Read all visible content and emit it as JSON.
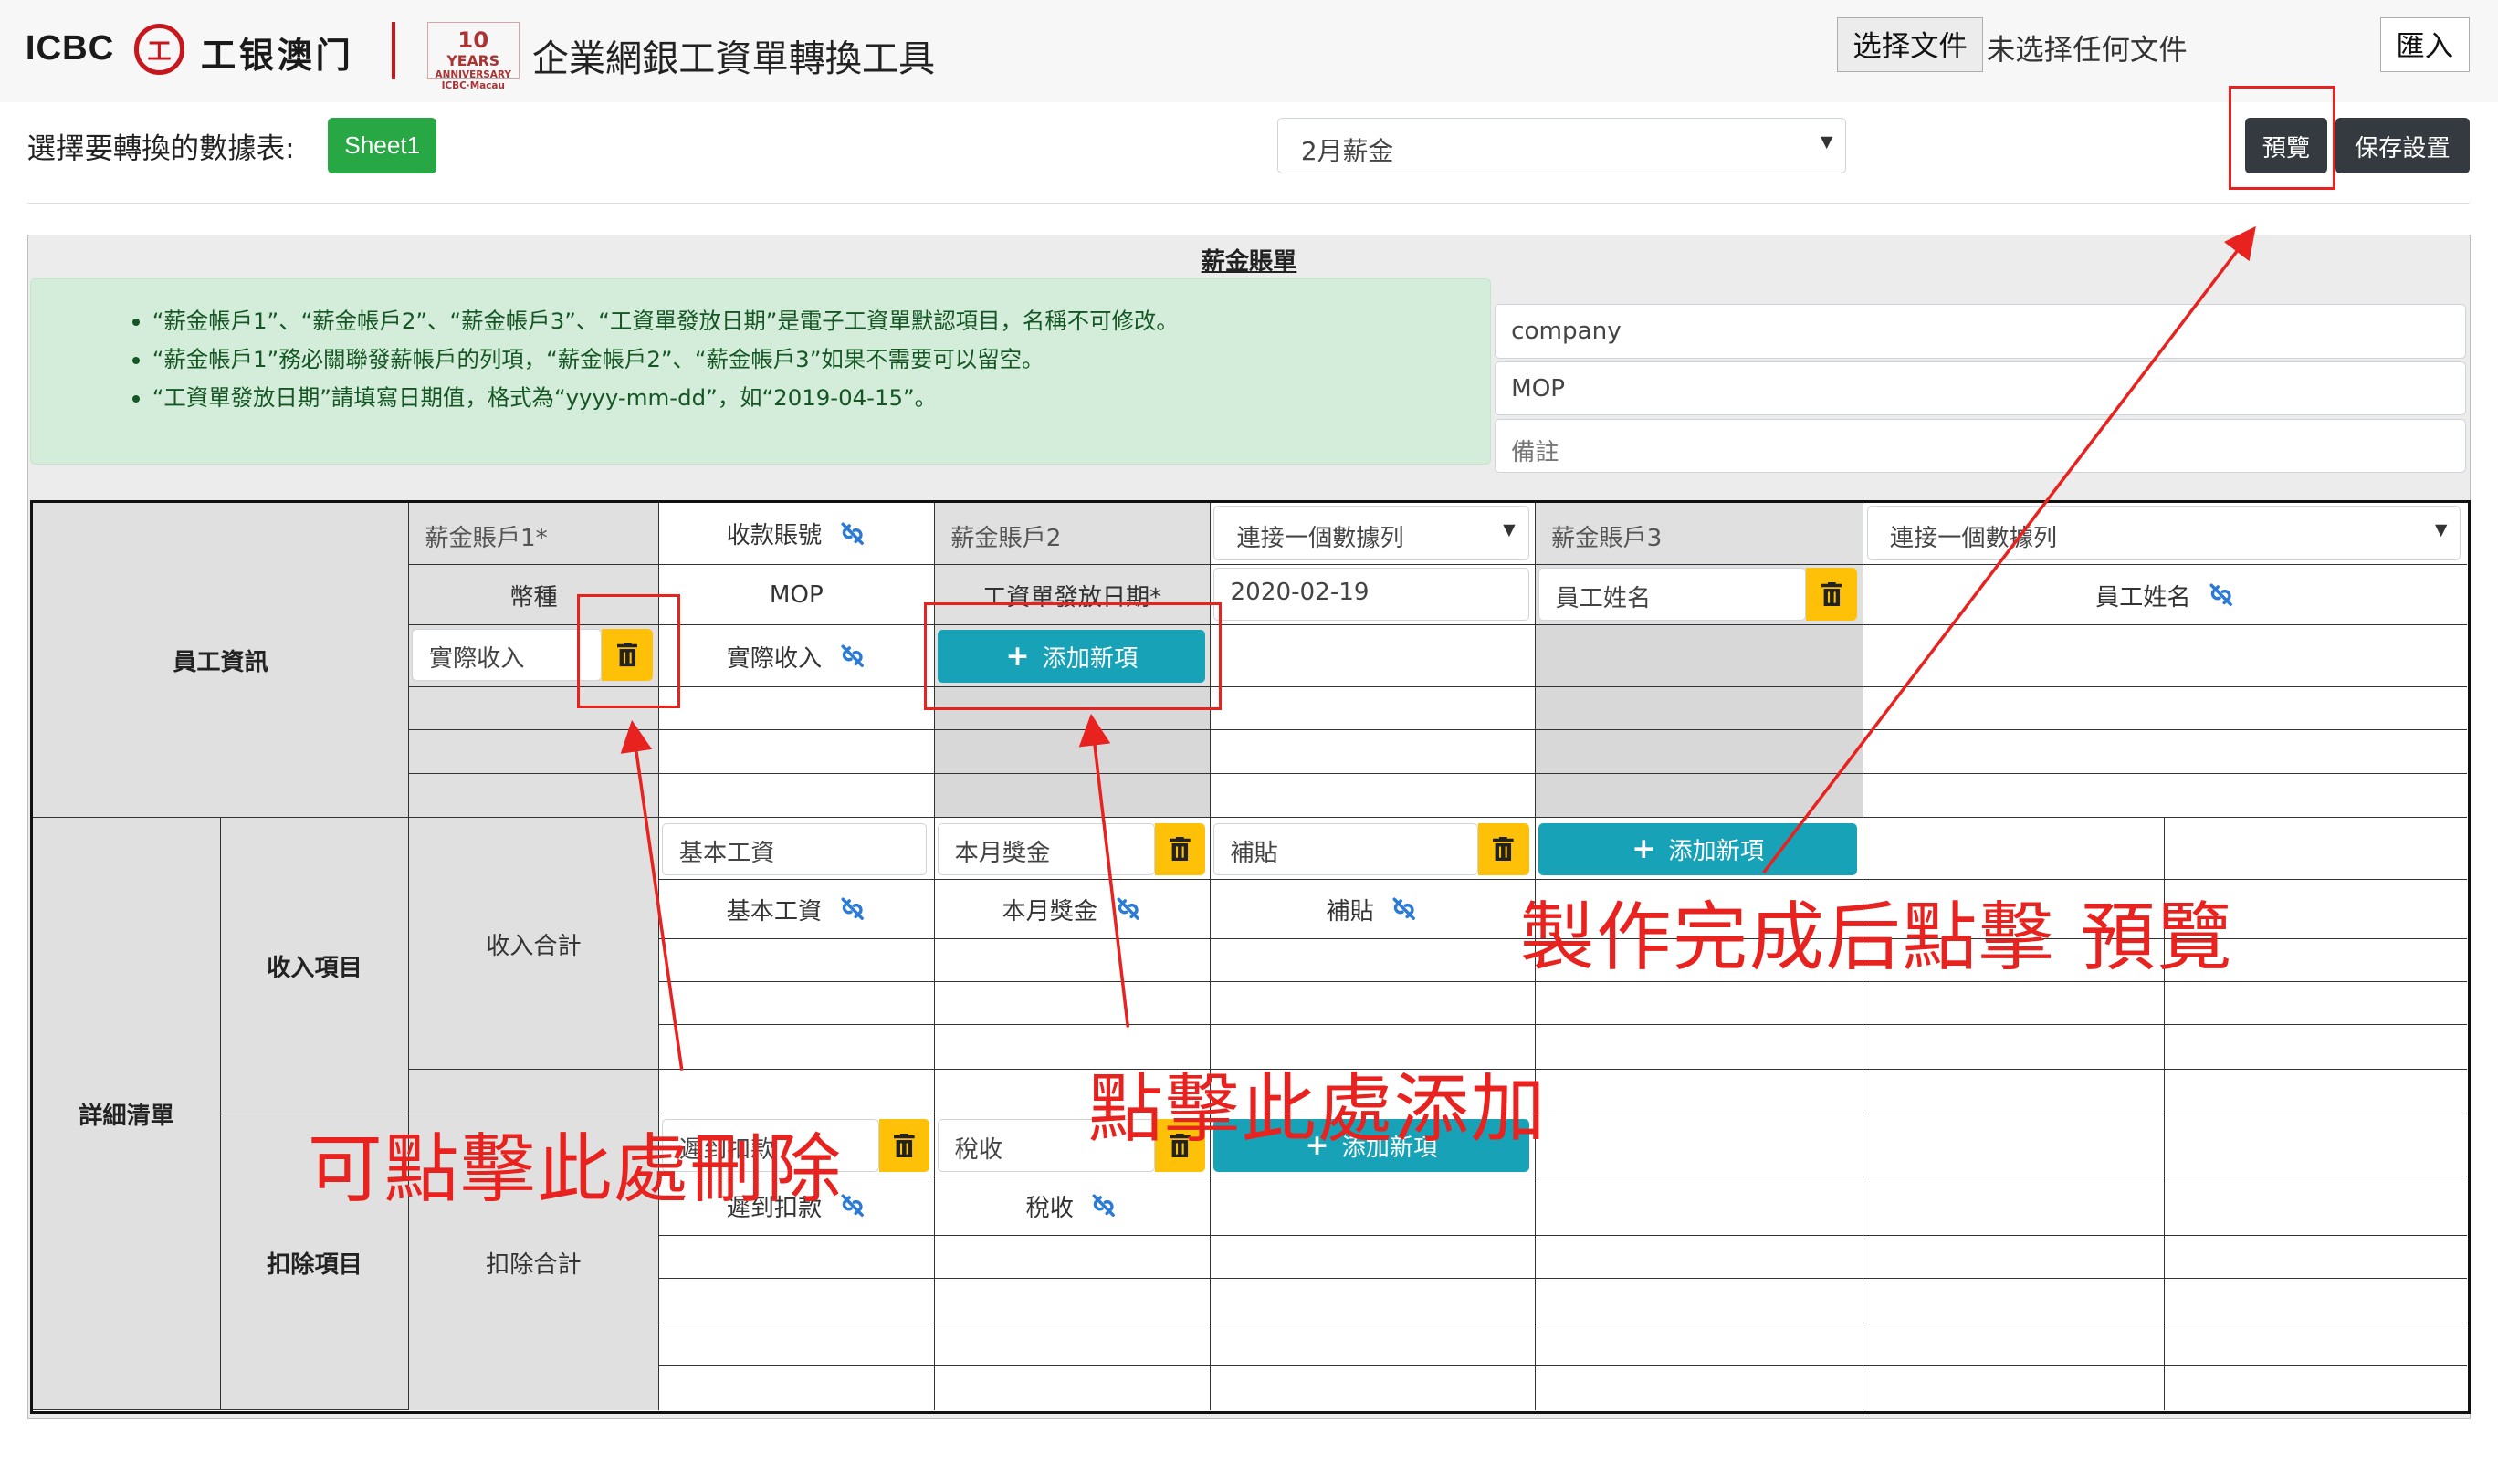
{
  "header": {
    "brand_latin": "ICBC",
    "brand_seal": "工",
    "brand_cn": "工银澳门",
    "anniversary": [
      "10",
      "YEARS",
      "ANNIVERSARY",
      "ICBC·Macau"
    ],
    "app_title": "企業網銀工資單轉換工具",
    "choose_file": "选择文件",
    "file_status": "未选择任何文件",
    "import_button": "匯入"
  },
  "toolbar": {
    "sheet_label": "選擇要轉換的數據表:",
    "sheet_button": "Sheet1",
    "template_select": "2月薪金",
    "preview_button": "預覽",
    "save_button": "保存設置"
  },
  "panel": {
    "title": "薪金賬單",
    "notes": [
      "“薪金帳戶1”、“薪金帳戶2”、“薪金帳戶3”、“工資單發放日期”是電子工資單默認項目，名稱不可修改。",
      "“薪金帳戶1”務必關聯發薪帳戶的列項，“薪金帳戶2”、“薪金帳戶3”如果不需要可以留空。",
      "“工資單發放日期”請填寫日期值，格式為“yyyy-mm-dd”，如“2019-04-15”。"
    ],
    "side_fields": [
      "company",
      "MOP",
      "備註"
    ]
  },
  "grid": {
    "employee_info": "員工資訊",
    "detail_list": "詳細清單",
    "income_items": "收入項目",
    "deduction_items": "扣除項目",
    "income_total": "收入合計",
    "deduction_total": "扣除合計",
    "account1": "薪金賬戶1*",
    "account1_link": "收款賬號",
    "account2": "薪金賬戶2",
    "account2_select": "連接一個數據列",
    "account3": "薪金賬戶3",
    "account3_select": "連接一個數據列",
    "currency_label": "幣種",
    "currency_value": "MOP",
    "pay_date_label": "工資單發放日期*",
    "pay_date_value": "2020-02-19",
    "employee_name_input": "員工姓名",
    "employee_name_link": "員工姓名",
    "actual_income_input": "實際收入",
    "actual_income_link": "實際收入",
    "add_new": "添加新項",
    "income": [
      {
        "input": "基本工資",
        "link": "基本工資"
      },
      {
        "input": "本月獎金",
        "link": "本月獎金"
      },
      {
        "input": "補貼",
        "link": "補貼"
      }
    ],
    "deductions": [
      {
        "input": "遲到扣款",
        "link": "遲到扣款"
      },
      {
        "input": "稅收",
        "link": "稅收"
      }
    ]
  },
  "annotations": {
    "delete_hint": "可點擊此處刪除",
    "add_hint": "點擊此處添加",
    "preview_hint": "製作完成后點擊 預覽",
    "color": "#e8231f"
  },
  "colors": {
    "success": "#28a745",
    "info": "#17a2b8",
    "warning": "#ffc107",
    "dark": "#343a40",
    "alert_bg": "#d4edda"
  }
}
